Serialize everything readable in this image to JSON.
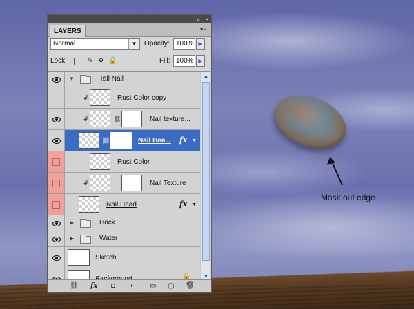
{
  "panel": {
    "tab_label": "LAYERS",
    "blend_mode": "Normal",
    "opacity_label": "Opacity:",
    "opacity_value": "100%",
    "lock_label": "Lock:",
    "fill_label": "Fill:",
    "fill_value": "100%"
  },
  "layers": [
    {
      "name": "Tall Nail",
      "kind": "group",
      "expanded": true
    },
    {
      "name": "Rust Color copy",
      "kind": "clipped-layer"
    },
    {
      "name": "Nail texture...",
      "kind": "clipped-layer-with-mask"
    },
    {
      "name": "Nail Hea...",
      "kind": "layer-with-mask-and-fx",
      "selected": true
    },
    {
      "name": "Rust Color",
      "kind": "layer"
    },
    {
      "name": "Nail Texture",
      "kind": "clipped-layer-with-mask"
    },
    {
      "name": "Nail Head",
      "kind": "layer-with-fx"
    },
    {
      "name": "Dock",
      "kind": "group",
      "expanded": false
    },
    {
      "name": "Water",
      "kind": "group",
      "expanded": false
    },
    {
      "name": "Sketch",
      "kind": "layer"
    },
    {
      "name": "Background",
      "kind": "locked-layer"
    }
  ],
  "annotation": {
    "text": "Mask out edge"
  },
  "icons": {
    "visibility": "eye-icon",
    "fx": "fx",
    "folder": "folder-icon",
    "link": "chain-icon",
    "lock": "lock-icon"
  },
  "colors": {
    "selection": "#3a6cc6",
    "hidden_layer_marker": "#f2a09a",
    "sky": "#6a70ad"
  }
}
